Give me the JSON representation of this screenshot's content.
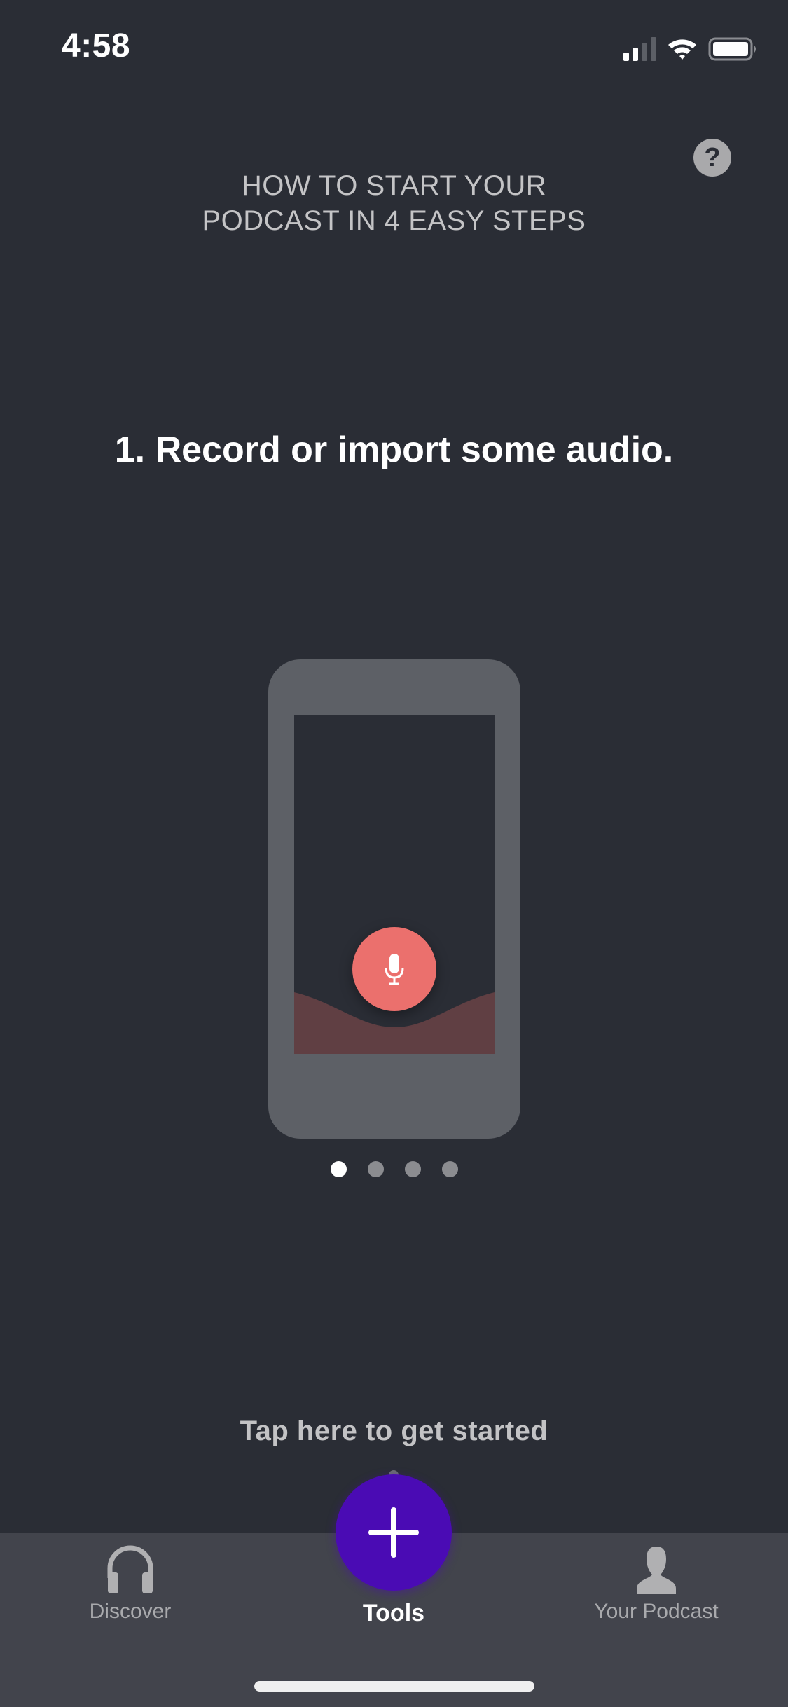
{
  "status_bar": {
    "time": "4:58",
    "signal_bars_active": 2,
    "signal_bars_total": 4,
    "wifi_icon": "wifi-icon",
    "battery_icon": "battery-icon"
  },
  "header": {
    "title_line1": "HOW TO START YOUR",
    "title_line2": "PODCAST IN 4 EASY STEPS",
    "help_label": "?"
  },
  "onboarding": {
    "step_text": "1. Record or import some audio.",
    "illustration_icon": "microphone-icon",
    "current_page": 1,
    "total_pages": 4
  },
  "cta": {
    "label": "Tap here to get started"
  },
  "tabbar": {
    "tabs": [
      {
        "label": "Discover",
        "icon": "headphones-icon",
        "active": false
      },
      {
        "label": "Tools",
        "icon": "plus-icon",
        "active": true
      },
      {
        "label": "Your Podcast",
        "icon": "person-icon",
        "active": false
      }
    ]
  },
  "colors": {
    "background": "#2a2d35",
    "accent": "#4a0bb4",
    "mic_button": "#eb706d",
    "tabbar": "#42444c"
  }
}
